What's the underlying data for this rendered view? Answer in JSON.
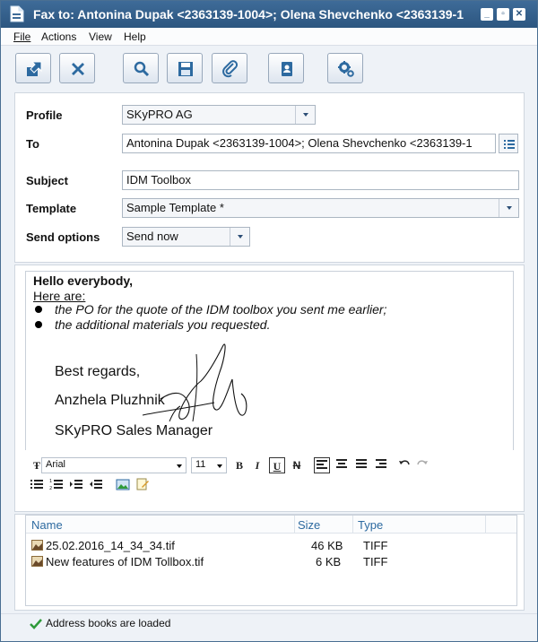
{
  "window": {
    "title": "Fax to: Antonina Dupak <2363139-1004>; Olena Shevchenko <2363139-1"
  },
  "menubar": {
    "file": "File",
    "actions": "Actions",
    "view": "View",
    "help": "Help"
  },
  "toolbar": {
    "buttons": [
      "send-icon",
      "delete-icon",
      "search-icon",
      "save-icon",
      "attach-icon",
      "address-book-icon",
      "settings-icon"
    ]
  },
  "form": {
    "profile_label": "Profile",
    "profile_value": "SKyPRO AG",
    "to_label": "To",
    "to_value": "Antonina Dupak <2363139-1004>; Olena Shevchenko <2363139-1",
    "subject_label": "Subject",
    "subject_value": "IDM Toolbox",
    "template_label": "Template",
    "template_value": "Sample Template *",
    "send_options_label": "Send options",
    "send_options_value": "Send now"
  },
  "editor": {
    "greeting": "Hello everybody,",
    "here_are": "Here are:",
    "bullet1": "the PO for the quote of the IDM toolbox you sent me earlier;",
    "bullet2": "the additional materials you requested.",
    "regards": "Best regards,",
    "name": "Anzhela Pluzhnik",
    "company": "SKyPRO Sales Manager"
  },
  "format_toolbar": {
    "font": "Arial",
    "size": "11",
    "bold": "B",
    "italic": "I",
    "underline": "U",
    "strike": "N"
  },
  "attachments": {
    "columns": {
      "name": "Name",
      "size": "Size",
      "type": "Type"
    },
    "rows": [
      {
        "name": "25.02.2016_14_34_34.tif",
        "size": "46 KB",
        "type": "TIFF"
      },
      {
        "name": "New features of IDM Tollbox.tif",
        "size": "6 KB",
        "type": "TIFF"
      }
    ]
  },
  "status": {
    "text": "Address books are loaded"
  },
  "colors": {
    "accent": "#2c5680",
    "icon_blue": "#2d6aa0",
    "status_green": "#2e9a3a"
  }
}
